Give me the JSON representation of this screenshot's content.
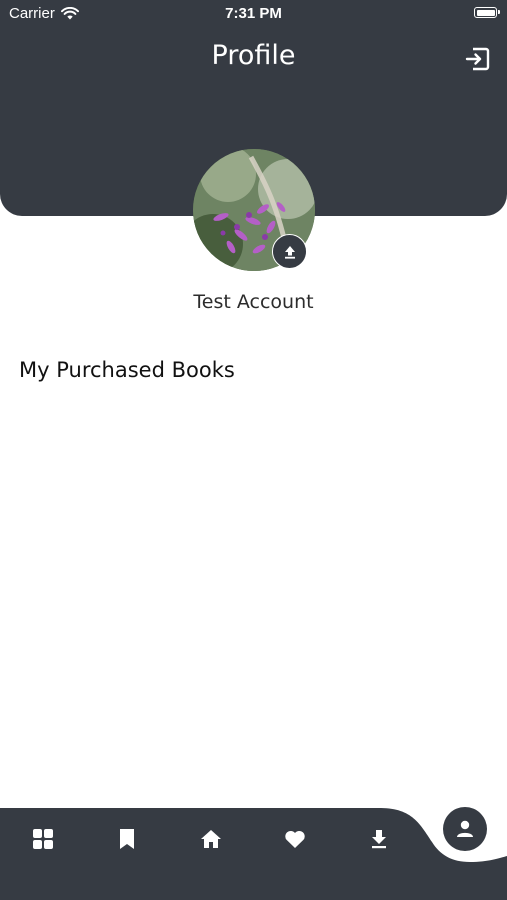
{
  "status_bar": {
    "carrier": "Carrier",
    "time": "7:31 PM"
  },
  "header": {
    "title": "Profile"
  },
  "profile": {
    "account_name": "Test Account"
  },
  "purchases": {
    "section_title": "My Purchased Books"
  },
  "bottom_nav": {
    "items": [
      {
        "icon": "grid-icon"
      },
      {
        "icon": "bookmark-icon"
      },
      {
        "icon": "home-icon"
      },
      {
        "icon": "heart-icon"
      },
      {
        "icon": "download-icon"
      },
      {
        "icon": "person-icon",
        "active": true
      }
    ]
  },
  "colors": {
    "header_bg": "#363b43",
    "background": "#ffffff",
    "icon": "#ffffff"
  }
}
